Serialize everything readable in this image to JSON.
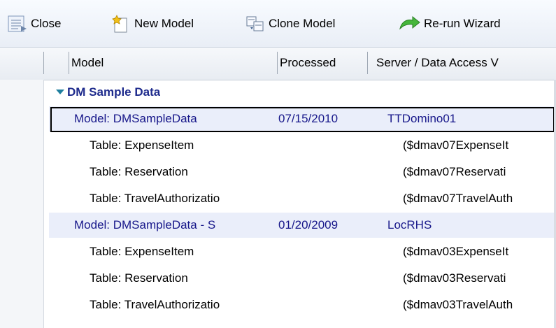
{
  "toolbar": {
    "buttons": [
      {
        "label": "Close",
        "icon": "close-panel-icon"
      },
      {
        "label": "New Model",
        "icon": "new-model-icon"
      },
      {
        "label": "Clone Model",
        "icon": "clone-model-icon"
      },
      {
        "label": "Re-run Wizard",
        "icon": "rerun-arrow-icon"
      }
    ]
  },
  "columns": [
    "Model",
    "Processed",
    "Server / Data Access V"
  ],
  "tree": {
    "group_label": "DM Sample Data",
    "rows": [
      {
        "kind": "model",
        "name": "Model:  DMSampleData",
        "processed": "07/15/2010",
        "server": "TTDomino01",
        "selected": true
      },
      {
        "kind": "table",
        "name": "Table:  ExpenseItem",
        "processed": "",
        "server": "($dmav07ExpenseIt"
      },
      {
        "kind": "table",
        "name": "Table:  Reservation",
        "processed": "",
        "server": "($dmav07Reservati"
      },
      {
        "kind": "table",
        "name": "Table:  TravelAuthorizatio",
        "processed": "",
        "server": "($dmav07TravelAuth"
      },
      {
        "kind": "model",
        "name": "Model:  DMSampleData - S",
        "processed": "01/20/2009",
        "server": "LocRHS"
      },
      {
        "kind": "table",
        "name": "Table:  ExpenseItem",
        "processed": "",
        "server": "($dmav03ExpenseIt"
      },
      {
        "kind": "table",
        "name": "Table:  Reservation",
        "processed": "",
        "server": "($dmav03Reservati"
      },
      {
        "kind": "table",
        "name": "Table:  TravelAuthorizatio",
        "processed": "",
        "server": "($dmav03TravelAuth"
      }
    ]
  },
  "colors": {
    "model_row_bg": "#eaeefa",
    "model_text": "#17178a",
    "group_text": "#1d2a8c"
  }
}
